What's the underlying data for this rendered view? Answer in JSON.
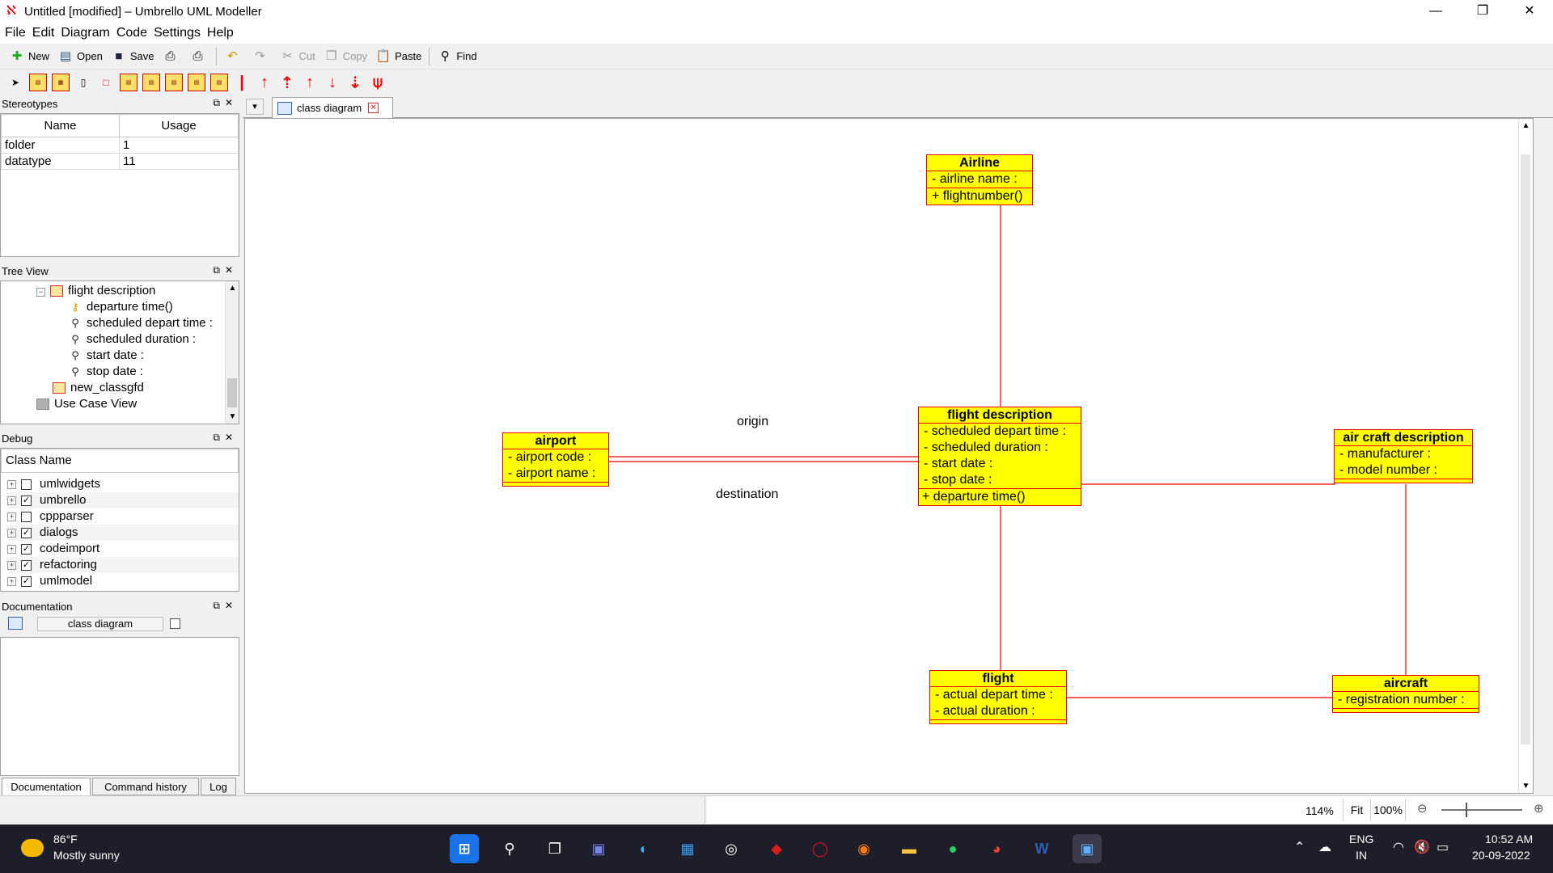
{
  "window": {
    "title": "Untitled [modified] – Umbrello UML Modeller",
    "controls": {
      "minimize": "—",
      "restore": "❐",
      "close": "✕"
    }
  },
  "menu": [
    "File",
    "Edit",
    "Diagram",
    "Code",
    "Settings",
    "Help"
  ],
  "toolbar": {
    "new": "New",
    "open": "Open",
    "save": "Save",
    "cut": "Cut",
    "copy": "Copy",
    "paste": "Paste",
    "find": "Find"
  },
  "stereotypes": {
    "title": "Stereotypes",
    "columns": [
      "Name",
      "Usage"
    ],
    "rows": [
      {
        "name": "folder",
        "usage": "1"
      },
      {
        "name": "datatype",
        "usage": "11"
      }
    ]
  },
  "tree_view": {
    "title": "Tree View",
    "items": [
      {
        "label": "flight description",
        "kind": "class"
      },
      {
        "label": "departure time()",
        "kind": "operation"
      },
      {
        "label": "scheduled depart time :",
        "kind": "attribute"
      },
      {
        "label": "scheduled duration :",
        "kind": "attribute"
      },
      {
        "label": "start date :",
        "kind": "attribute"
      },
      {
        "label": "stop date :",
        "kind": "attribute"
      },
      {
        "label": "new_classgfd",
        "kind": "class"
      },
      {
        "label": "Use Case View",
        "kind": "folder"
      }
    ]
  },
  "debug": {
    "title": "Debug",
    "column": "Class Name",
    "rows": [
      {
        "label": "umlwidgets",
        "checked": false
      },
      {
        "label": "umbrello",
        "checked": true
      },
      {
        "label": "cppparser",
        "checked": false
      },
      {
        "label": "dialogs",
        "checked": true
      },
      {
        "label": "codeimport",
        "checked": true
      },
      {
        "label": "refactoring",
        "checked": true
      },
      {
        "label": "umlmodel",
        "checked": true
      }
    ]
  },
  "documentation": {
    "title": "Documentation",
    "diagram_name": "class diagram"
  },
  "bottom_tabs": [
    "Documentation",
    "Command history",
    "Log"
  ],
  "document_tab": "class diagram",
  "diagram": {
    "classes": {
      "airline": {
        "name": "Airline",
        "attributes": [
          "- airline name :"
        ],
        "operations": [
          "+ flightnumber()"
        ]
      },
      "airport": {
        "name": "airport",
        "attributes": [
          "- airport code :",
          "- airport name :"
        ],
        "operations": []
      },
      "flight_description": {
        "name": "flight description",
        "attributes": [
          "- scheduled depart time :",
          "- scheduled duration :",
          "- start date :",
          "- stop date :"
        ],
        "operations": [
          "+ departure time()"
        ]
      },
      "aircraft_description": {
        "name": "air craft description",
        "attributes": [
          "- manufacturer :",
          "- model number :"
        ],
        "operations": []
      },
      "flight": {
        "name": "flight",
        "attributes": [
          "- actual depart time :",
          "- actual duration :"
        ],
        "operations": []
      },
      "aircraft": {
        "name": "aircraft",
        "attributes": [
          "- registration number :"
        ],
        "operations": []
      }
    },
    "labels": {
      "origin": "origin",
      "destination": "destination"
    },
    "line_color": "#e00000",
    "class_fill": "#ffff00"
  },
  "statusbar": {
    "zoom": "114%",
    "fit": "Fit",
    "hundred": "100%"
  },
  "taskbar": {
    "weather_temp": "86°F",
    "weather_text": "Mostly sunny",
    "lang": "ENG",
    "region": "IN",
    "time": "10:52 AM",
    "date": "20-09-2022"
  }
}
